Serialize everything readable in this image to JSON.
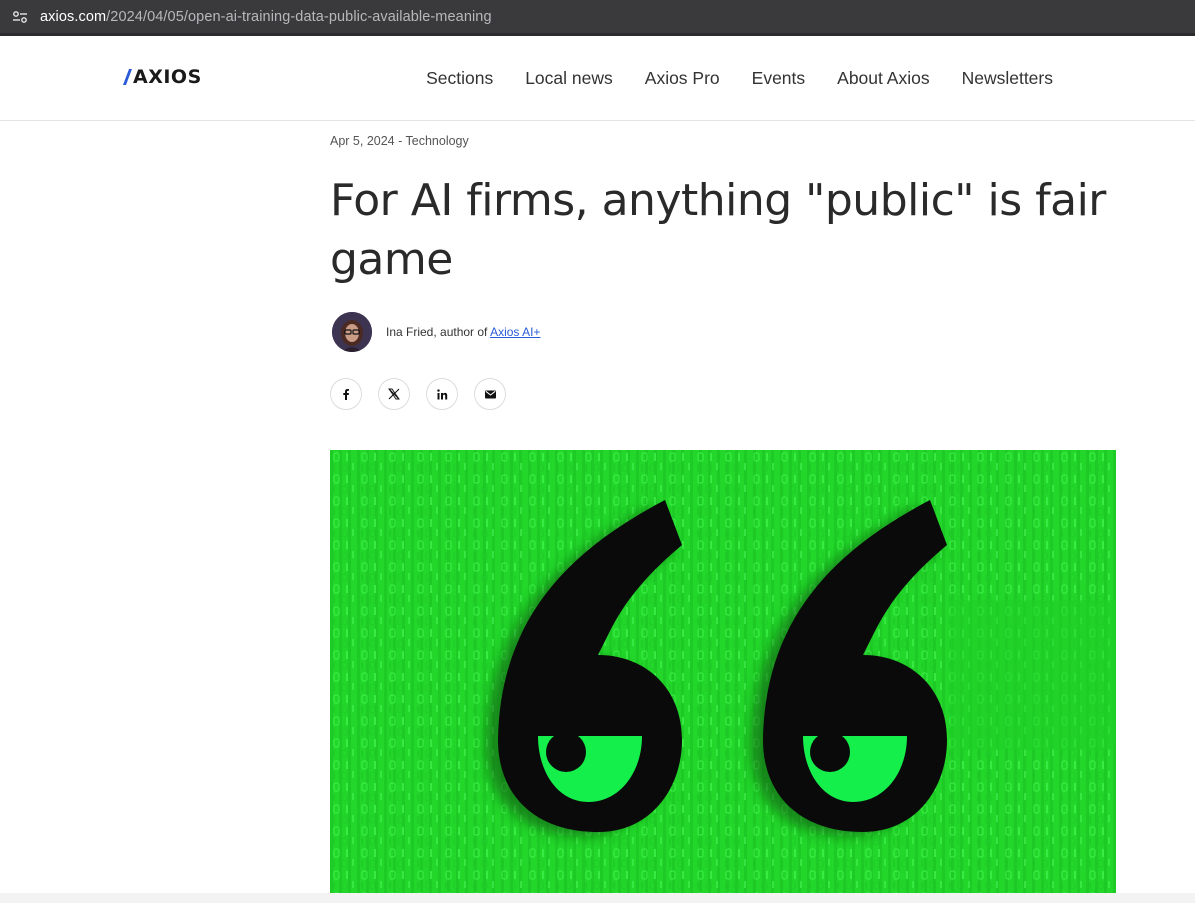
{
  "browser": {
    "url_domain": "axios.com",
    "url_path": "/2024/04/05/open-ai-training-data-public-available-meaning"
  },
  "header": {
    "logo_text": "AXIOS",
    "nav": [
      {
        "label": "Sections"
      },
      {
        "label": "Local news"
      },
      {
        "label": "Axios Pro"
      },
      {
        "label": "Events"
      },
      {
        "label": "About Axios"
      },
      {
        "label": "Newsletters"
      }
    ]
  },
  "article": {
    "dateline": "Apr 5, 2024 - Technology",
    "headline": "For AI firms, anything \"public\" is fair game",
    "byline": {
      "author_text": "Ina Fried, author of ",
      "newsletter_link": "Axios AI+"
    },
    "share": [
      {
        "icon": "facebook-icon"
      },
      {
        "icon": "x-icon"
      },
      {
        "icon": "linkedin-icon"
      },
      {
        "icon": "email-icon"
      }
    ]
  },
  "colors": {
    "brand_blue": "#2a5bd7",
    "hero_green": "#22d62a",
    "eye_green": "#14ef4c"
  }
}
